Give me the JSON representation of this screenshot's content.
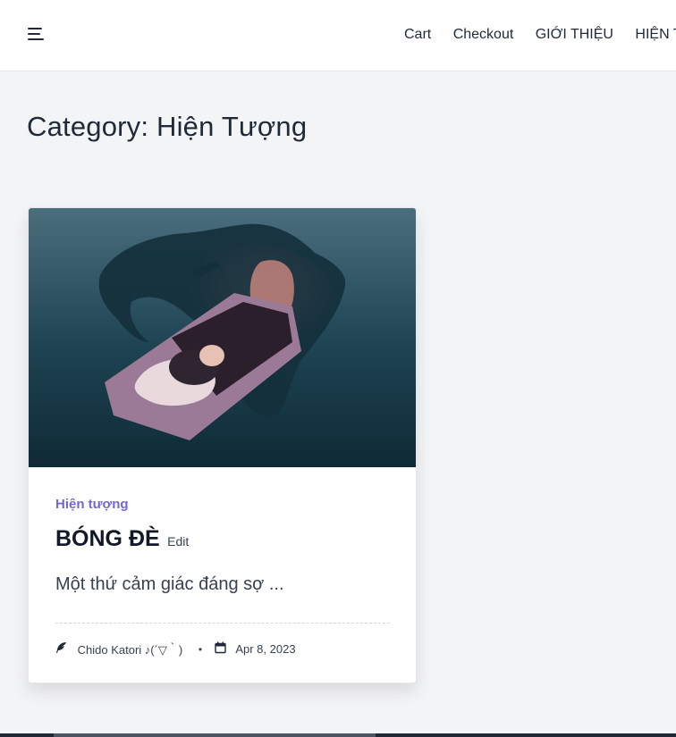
{
  "header": {
    "menu_icon": "hamburger-icon",
    "nav": [
      {
        "label": "Cart"
      },
      {
        "label": "Checkout"
      },
      {
        "label": "GIỚI THIỆU"
      },
      {
        "label": "HIỆN TƯ"
      }
    ]
  },
  "main": {
    "page_title": "Category: Hiện Tượng"
  },
  "post": {
    "image_icon": "sleep-paralysis-illustration",
    "category": "Hiện tượng",
    "title": "BÓNG ĐÈ",
    "edit_label": "Edit",
    "excerpt": "Một thứ cảm giác đáng sợ ...",
    "author_icon": "feather-icon",
    "author": "Chido Katori ♪(´▽｀)",
    "separator": "•",
    "date_icon": "calendar-icon",
    "date": "Apr 8, 2023"
  },
  "colors": {
    "accent": "#6f68d6",
    "background": "#f3f4f6",
    "text": "#1f2937"
  }
}
